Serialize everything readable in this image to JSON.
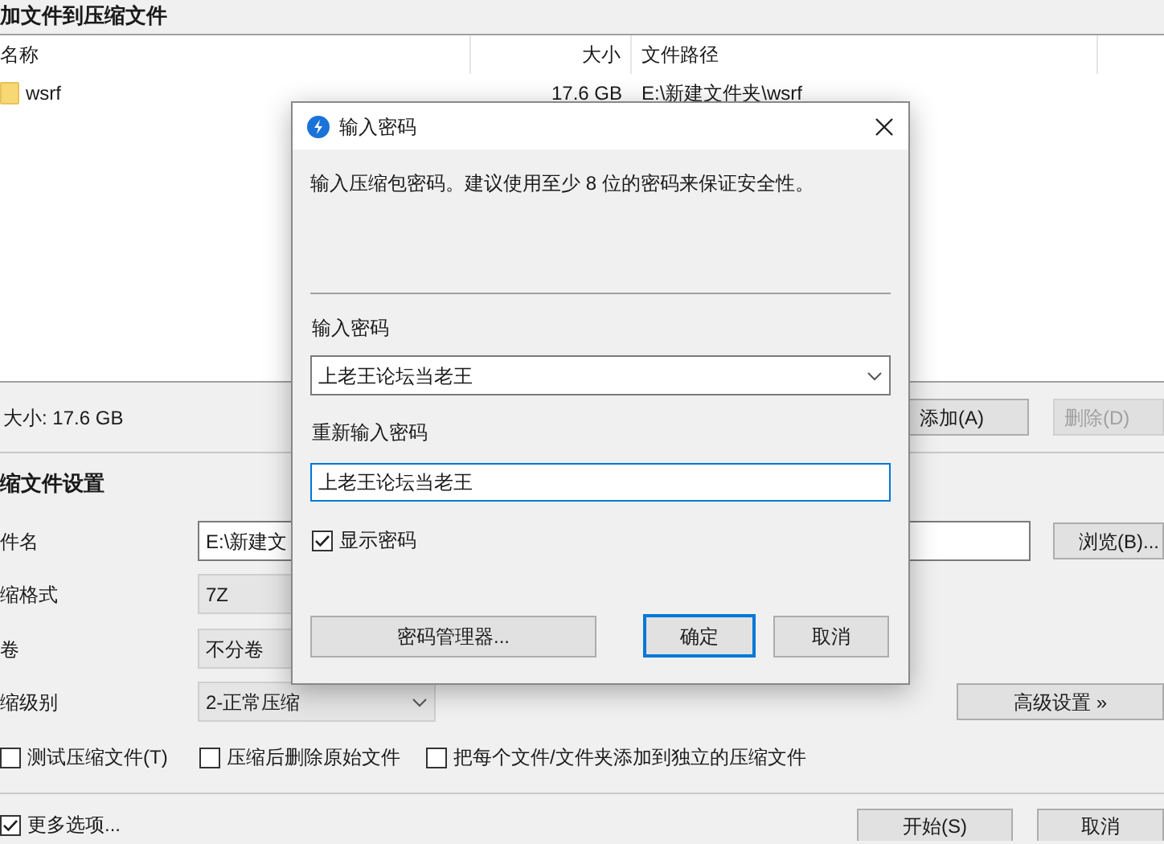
{
  "window": {
    "title": "加文件到压缩文件"
  },
  "file_list": {
    "columns": [
      "名称",
      "大小",
      "文件路径"
    ],
    "rows": [
      {
        "name": "wsrf",
        "size": "17.6 GB",
        "path": "E:\\新建文件夹\\wsrf"
      }
    ]
  },
  "total_size": "大小: 17.6 GB",
  "list_buttons": [
    {
      "label": "添加(A)",
      "disabled": false
    },
    {
      "label": "删除(D)",
      "disabled": true
    }
  ],
  "settings": {
    "title": "缩文件设置",
    "filename": {
      "label": "件名",
      "value": "E:\\新建文",
      "browse": "浏览(B)..."
    },
    "format": {
      "label": "缩格式",
      "value": "7Z"
    },
    "volume": {
      "label": "卷",
      "value": "不分卷"
    },
    "level": {
      "label": "缩级别",
      "value": "2-正常压缩"
    },
    "advanced": "高级设置 »",
    "options": [
      {
        "label": "测试压缩文件(T)",
        "checked": false
      },
      {
        "label": "压缩后删除原始文件",
        "checked": false
      },
      {
        "label": "把每个文件/文件夹添加到独立的压缩文件",
        "checked": false
      }
    ]
  },
  "more_options": {
    "label": "更多选项...",
    "checked": true
  },
  "footer_buttons": [
    "开始(S)",
    "取消"
  ],
  "dialog": {
    "title": "输入密码",
    "message": "输入压缩包密码。建议使用至少 8 位的密码来保证安全性。",
    "password_label": "输入密码",
    "password": "上老王论坛当老王",
    "repeat_label": "重新输入密码",
    "repeat": "上老王论坛当老王",
    "show_password": {
      "label": "显示密码",
      "checked": true
    },
    "buttons": [
      {
        "label": "密码管理器...",
        "kind": "wide"
      },
      {
        "label": "确定",
        "kind": "default"
      },
      {
        "label": "取消",
        "kind": "normal"
      }
    ]
  }
}
